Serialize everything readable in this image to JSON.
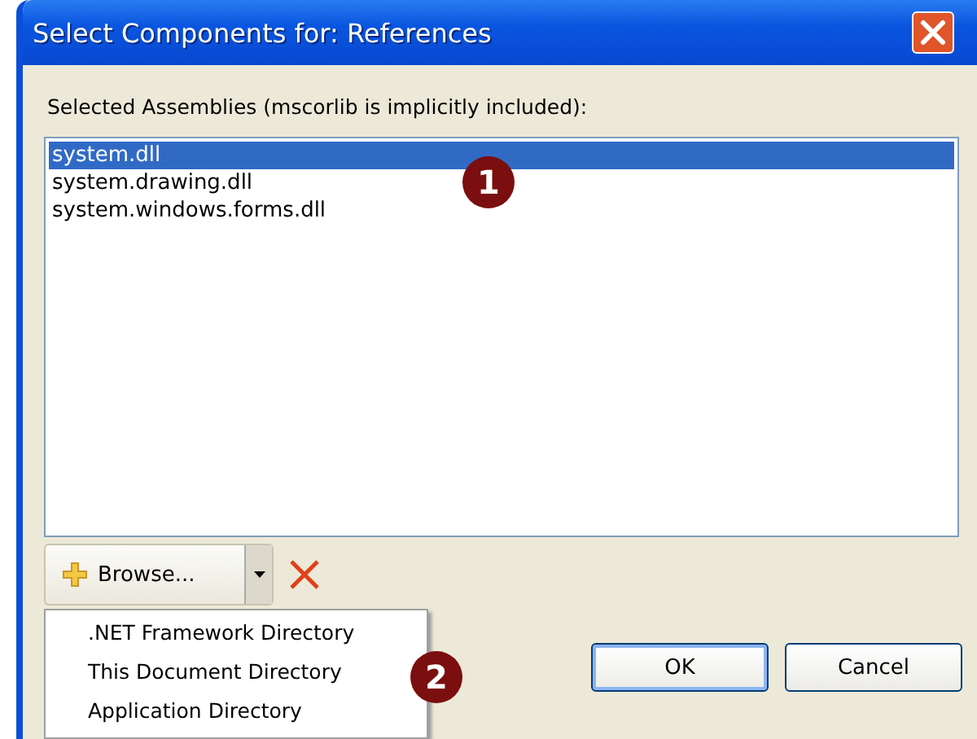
{
  "window": {
    "title": "Select Components for: References"
  },
  "assemblies": {
    "label": "Selected Assemblies (mscorlib is implicitly included):",
    "items": [
      {
        "text": "system.dll",
        "selected": true
      },
      {
        "text": "system.drawing.dll",
        "selected": false
      },
      {
        "text": "system.windows.forms.dll",
        "selected": false
      }
    ]
  },
  "browse": {
    "label": "Browse..."
  },
  "browse_menu": {
    "items": [
      ".NET Framework Directory",
      "This Document Directory",
      "Application Directory"
    ]
  },
  "buttons": [
    {
      "label": "OK",
      "default": true
    },
    {
      "label": "Cancel",
      "default": false
    }
  ],
  "callouts": [
    "1",
    "2"
  ]
}
